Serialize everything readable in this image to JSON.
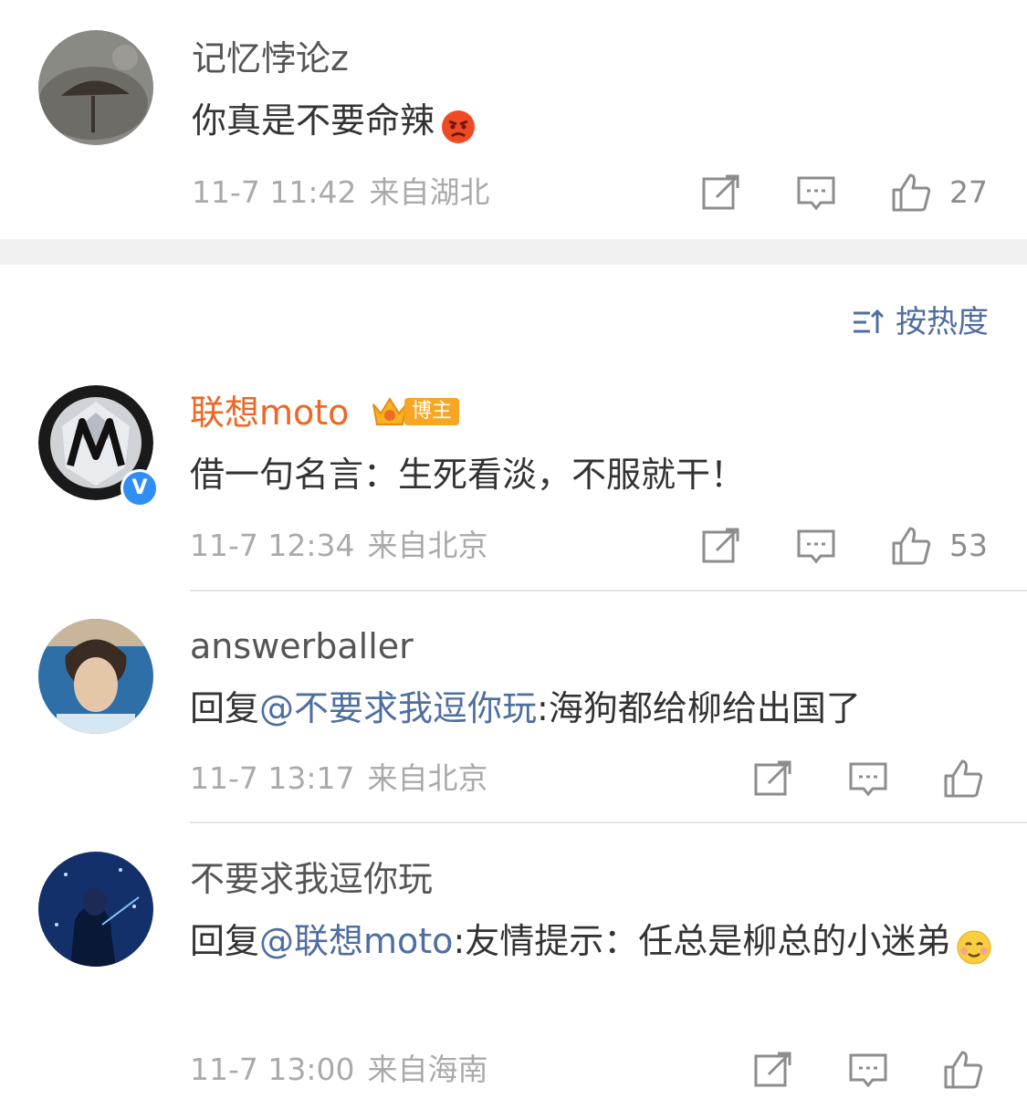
{
  "comments": [
    {
      "name": "记忆悖论z",
      "text": "你真是不要命辣",
      "emoji": "angry-face",
      "time": "11-7 11:42",
      "location": "来自湖北",
      "likes": "27"
    },
    {
      "name": "联想moto",
      "badge": "博主",
      "verified": "V",
      "text": "借一句名言：生死看淡，不服就干！",
      "time": "11-7 12:34",
      "location": "来自北京",
      "likes": "53"
    },
    {
      "name": "answerballer",
      "reply_prefix": "回复",
      "mention": "@不要求我逗你玩",
      "text": ":海狗都给柳给出国了",
      "time": "11-7 13:17",
      "location": "来自北京"
    },
    {
      "name": "不要求我逗你玩",
      "reply_prefix": "回复",
      "mention": "@联想moto",
      "text": ":友情提示：任总是柳总的小迷弟",
      "emoji": "smiling-face",
      "time": "11-7 13:00",
      "location": "来自海南"
    }
  ],
  "sort_label": "按热度",
  "colors": {
    "vip_name": "#f26522",
    "mention": "#4f6ea0",
    "meta": "#aaaaaa",
    "divider": "#e6e6e6"
  }
}
